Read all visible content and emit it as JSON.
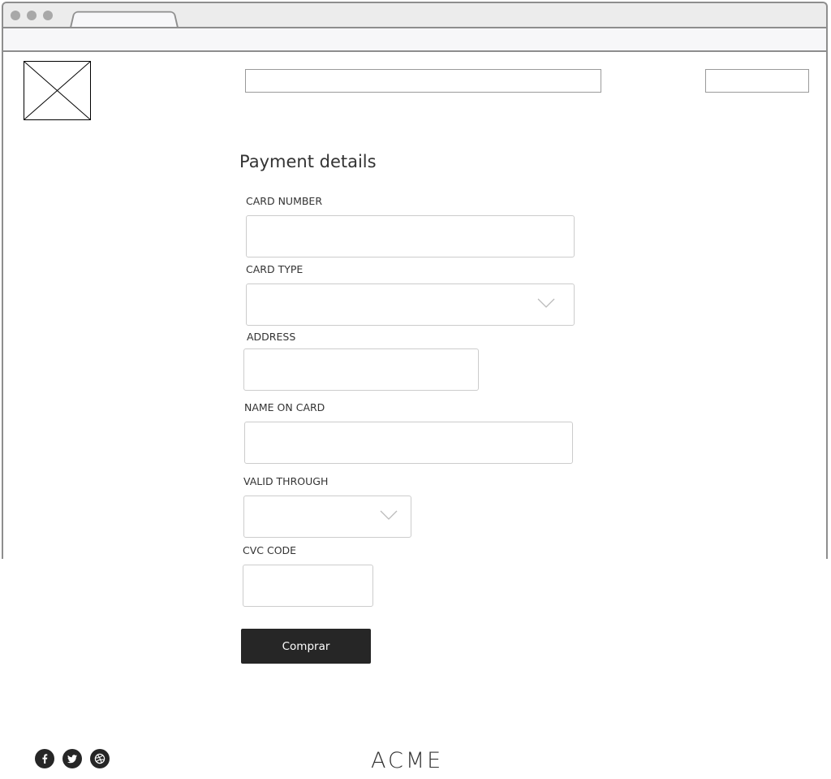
{
  "form": {
    "title": "Payment details",
    "fields": [
      {
        "label": "CARD NUMBER"
      },
      {
        "label": "CARD TYPE"
      },
      {
        "label": "ADDRESS"
      },
      {
        "label": "NAME ON CARD"
      },
      {
        "label": "VALID THROUGH"
      },
      {
        "label": "CVC CODE"
      }
    ],
    "submit_label": "Comprar"
  },
  "footer": {
    "brand": "ACME",
    "social_icons": [
      "facebook-icon",
      "twitter-icon",
      "dribbble-icon"
    ]
  },
  "colors": {
    "button_bg": "#262626",
    "button_text": "#ffffff",
    "chrome_border": "#8e8e8e",
    "chrome_bg": "#ececec",
    "input_border": "#cccccc"
  }
}
